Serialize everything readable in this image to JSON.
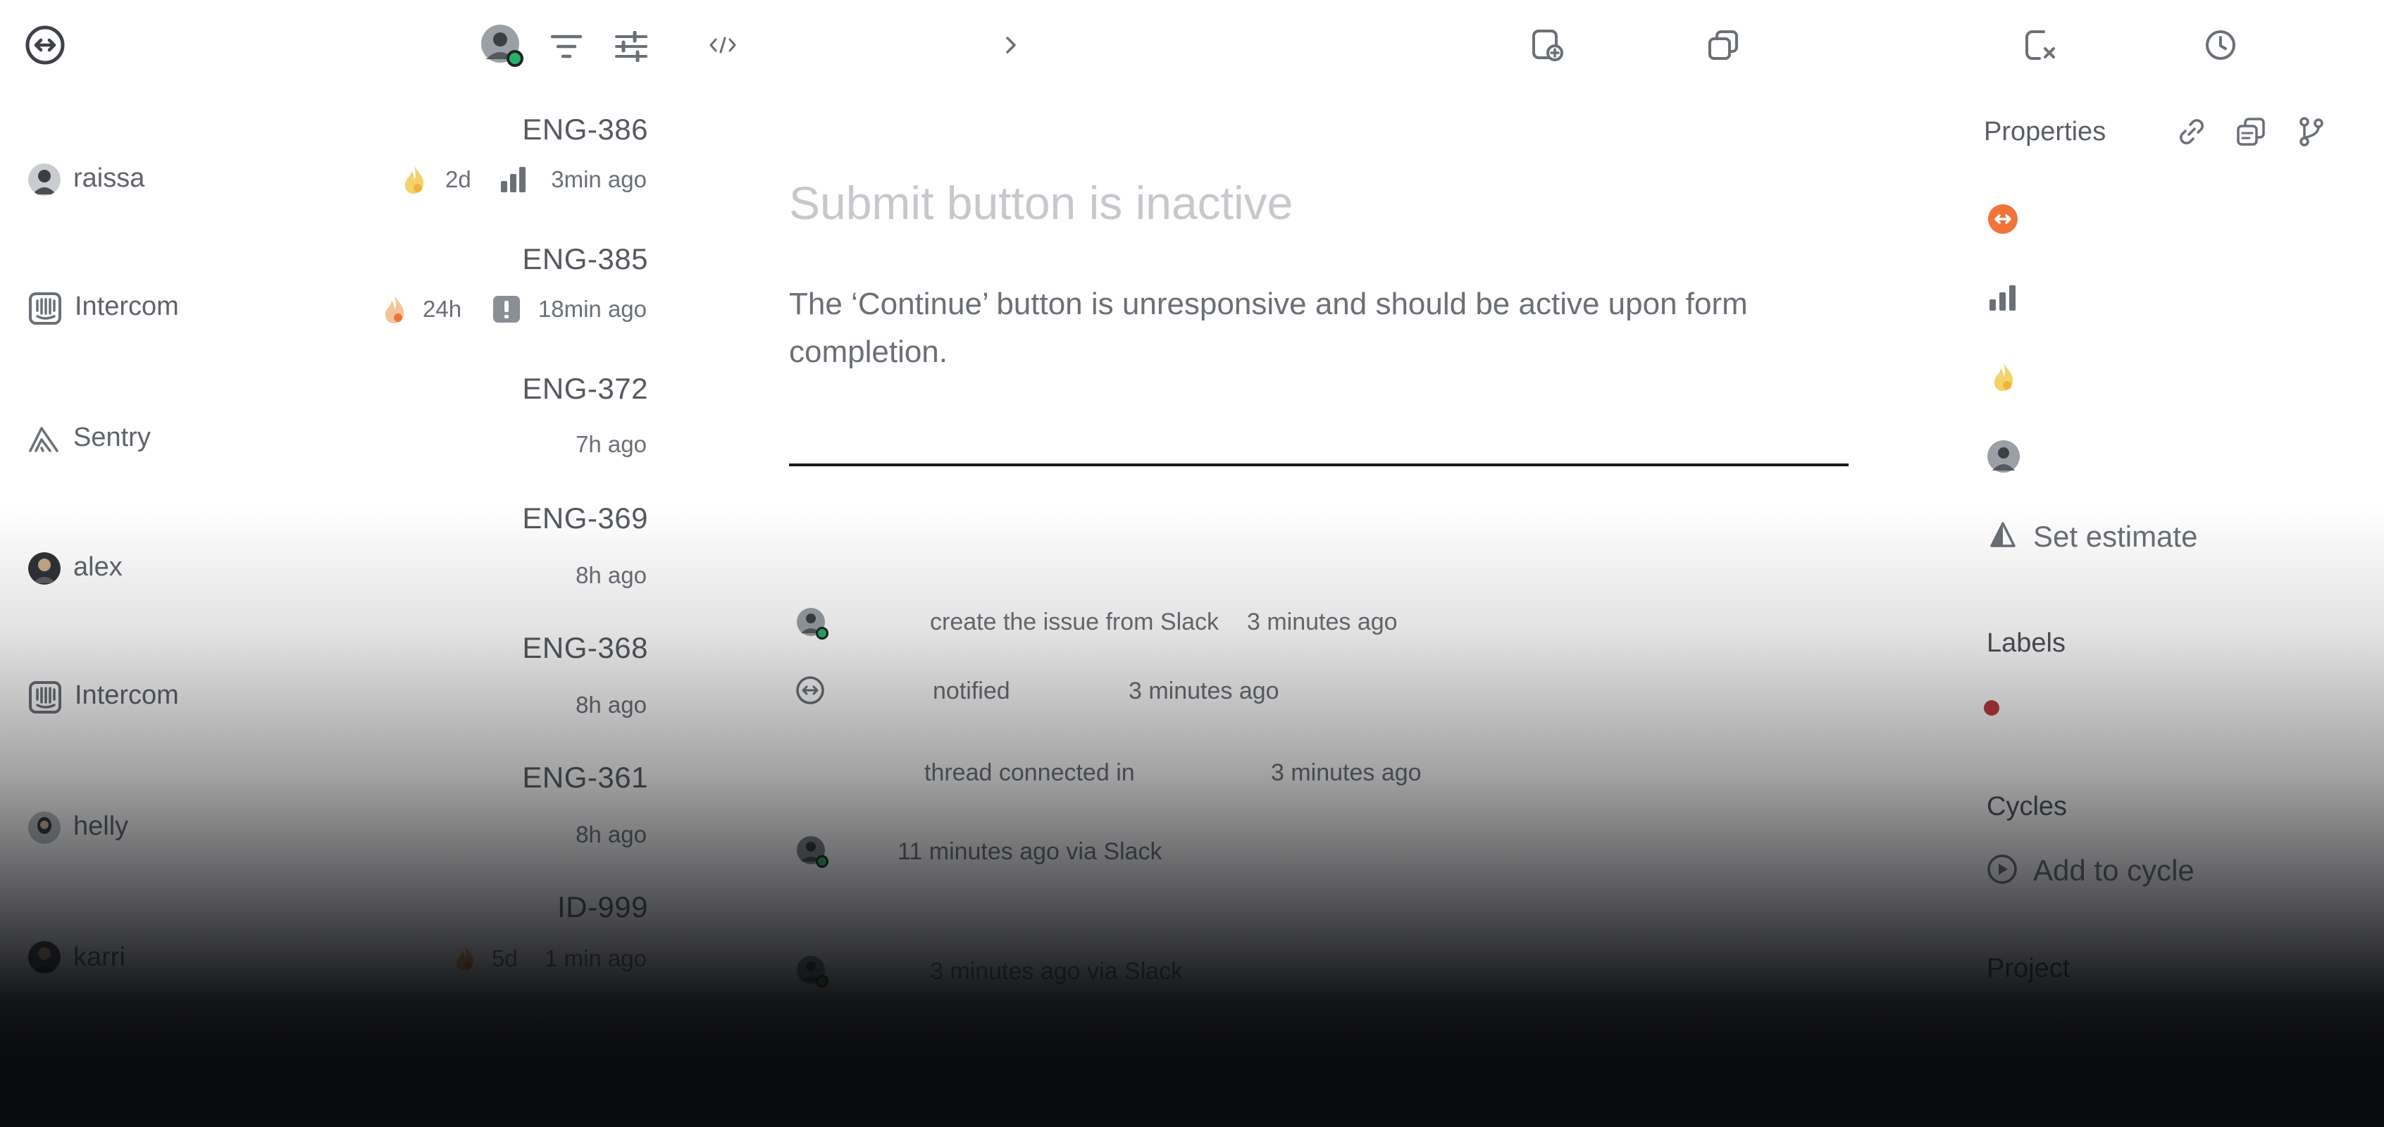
{
  "app": {
    "logo": "linear-circle-arrows-icon"
  },
  "toolbar": {
    "left": [
      "user-avatar",
      "filter-icon",
      "sliders-icon"
    ],
    "main": [
      "code-icon",
      "chevron-right-icon",
      "new-doc-icon",
      "duplicate-icon",
      "close-doc-icon",
      "history-icon"
    ]
  },
  "issues": [
    {
      "id": "ENG-386",
      "name": "raissa",
      "source": "avatar",
      "estimate": "2d",
      "priority": "bars",
      "time": "3min ago"
    },
    {
      "id": "ENG-385",
      "name": "Intercom",
      "source": "intercom",
      "estimate": "24h",
      "priority": "urgent",
      "time": "18min ago"
    },
    {
      "id": "ENG-372",
      "name": "Sentry",
      "source": "sentry",
      "time": "7h ago"
    },
    {
      "id": "ENG-369",
      "name": "alex",
      "source": "avatar",
      "time": "8h ago"
    },
    {
      "id": "ENG-368",
      "name": "Intercom",
      "source": "intercom",
      "time": "8h ago"
    },
    {
      "id": "ENG-361",
      "name": "helly",
      "source": "avatar",
      "time": "8h ago"
    },
    {
      "id": "ID-999",
      "name": "karri",
      "source": "avatar",
      "estimate": "5d",
      "time": "1 min ago"
    }
  ],
  "issue": {
    "title": "Submit button is inactive",
    "description": "The ‘Continue’ button is unresponsive and should be active upon form completion."
  },
  "activity": [
    {
      "text": "create the issue from Slack",
      "time": "3 minutes ago"
    },
    {
      "text": "notified",
      "time": "3 minutes ago"
    },
    {
      "text": "thread connected in",
      "time": "3 minutes ago"
    },
    {
      "text": "11 minutes ago via Slack"
    },
    {
      "text": "3 minutes ago via Slack"
    }
  ],
  "properties": {
    "heading": "Properties",
    "estimate_label": "Set estimate",
    "labels_heading": "Labels",
    "label_color": "#c0393b",
    "cycles_heading": "Cycles",
    "add_cycle": "Add to cycle",
    "project_heading": "Project"
  },
  "colors": {
    "accent_orange": "#f0743a",
    "online_green": "#25b26a",
    "urgent_gray": "#8a8e95",
    "flame_yellow": "#f2c94c"
  }
}
